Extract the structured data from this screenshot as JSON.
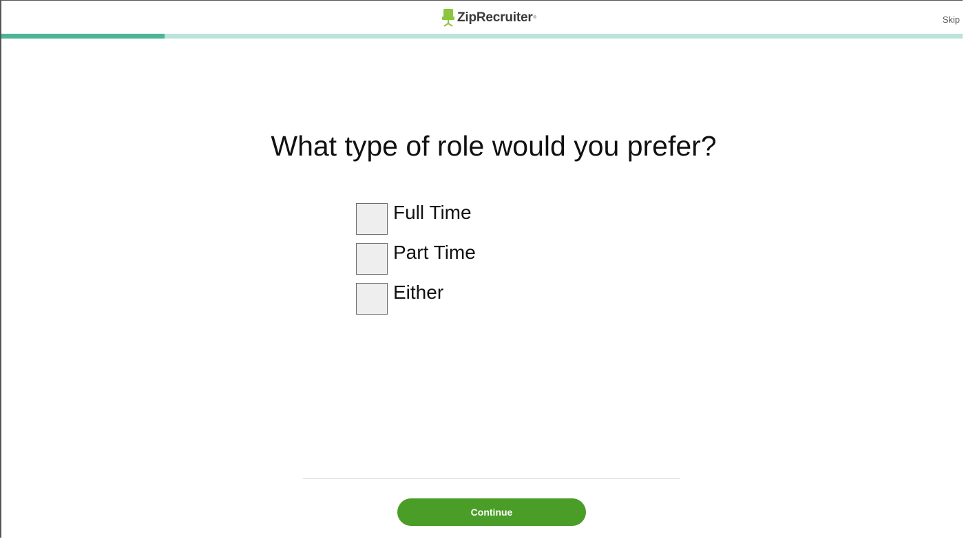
{
  "header": {
    "brand_name": "ZipRecruiter",
    "brand_mark": "®",
    "logo_icon": "chair-icon",
    "skip_label": "Skip",
    "progress_fraction": 0.17
  },
  "question": {
    "title": "What type of role would you prefer?",
    "options": [
      {
        "label": "Full Time",
        "checked": false
      },
      {
        "label": "Part Time",
        "checked": false
      },
      {
        "label": "Either",
        "checked": false
      }
    ]
  },
  "footer": {
    "continue_label": "Continue"
  },
  "colors": {
    "progress_fill": "#4cb497",
    "progress_track": "#b9e4d9",
    "logo_chair": "#8cc63f",
    "button": "#4a9d27"
  }
}
